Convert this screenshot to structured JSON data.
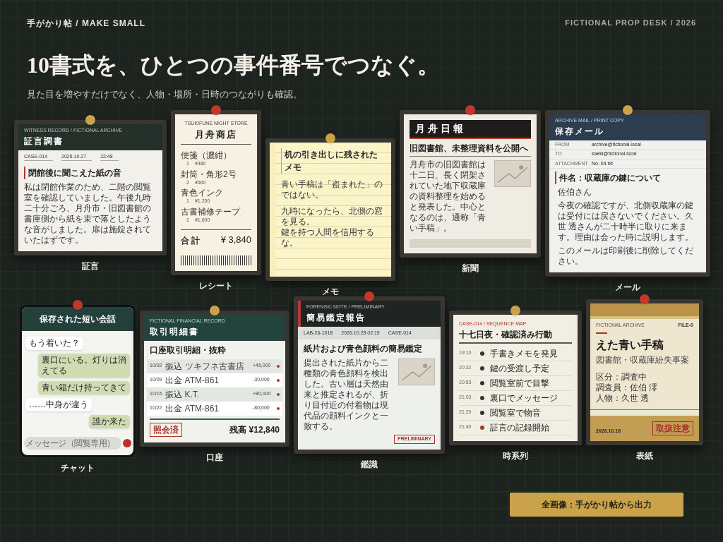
{
  "header": {
    "brand": "手がかり帖 / MAKE SMALL",
    "desk": "FICTIONAL PROP DESK / 2026"
  },
  "title": "10書式を、ひとつの事件番号でつなぐ。",
  "subtitle": "見た目を増やすだけでなく、人物・場所・日時のつながりも確認。",
  "cards": [
    {
      "kind": "testimony",
      "label": "証言",
      "color": "#c9a24a",
      "kicker": "WITNESS RECORD / FICTIONAL ARCHIVE",
      "header": "証言調書",
      "fields": [
        "CASE-014",
        "2026.10.27",
        "22:48"
      ],
      "heading": "閉館後に聞こえた紙の音",
      "body": "私は閉館作業のため、二階の閲覧室を確認していました。午後九時二十分ごろ、月舟市・旧図書館の書庫側から紙を束で落としたような音がしました。扉は施錠されていたはずです。"
    },
    {
      "kind": "receipt",
      "label": "レシート",
      "color": "#c0392b",
      "store_en": "TSUKIFUNE NIGHT STORE",
      "store": "月舟商店",
      "items": [
        {
          "name": "便箋（濃紺）",
          "qty": "1",
          "price": "¥480"
        },
        {
          "name": "封筒・角形2号",
          "qty": "2",
          "price": "¥560"
        },
        {
          "name": "青色インク",
          "qty": "1",
          "price": "¥1,200"
        },
        {
          "name": "古書補修テープ",
          "qty": "1",
          "price": "¥1,600"
        }
      ],
      "total_label": "合 計",
      "total": "¥ 3,840"
    },
    {
      "kind": "memo",
      "label": "メモ",
      "color": "#c9a24a",
      "heading": "机の引き出しに残されたメモ",
      "paragraphs": [
        [
          "青い手稿は「盗まれた」のではない。"
        ],
        [
          "九時になったら、北側の窓を見る。",
          "鍵を持つ人間を信用するな。"
        ]
      ]
    },
    {
      "kind": "news",
      "label": "新聞",
      "color": "#c0392b",
      "masthead": "月舟日報",
      "headline": "旧図書館、未整理資料を公開へ",
      "body": "月舟市の旧図書館は十二日、長く閉架されていた地下収蔵庫の資料整理を始めると発表した。中心となるのは、通称「青い手稿」。"
    },
    {
      "kind": "mail",
      "label": "メール",
      "color": "#c9a24a",
      "kicker": "ARCHIVE MAIL / PRINT COPY",
      "header": "保存メール",
      "rows": [
        {
          "key": "FROM",
          "value": "archive@fictional.local"
        },
        {
          "key": "TO",
          "value": "saeki@fictional.local"
        },
        {
          "key": "ATTACHMENT",
          "value": "No. 04.txt"
        }
      ],
      "subject": "件名：収蔵庫の鍵について",
      "paragraphs": [
        "佐伯さん",
        "今夜の確認ですが、北側収蔵庫の鍵は受付には戻さないでください。久世 透さんが二十時半に取りに来ます。理由は会った時に説明します。",
        "このメールは印刷後に削除してください。"
      ]
    },
    {
      "kind": "chat",
      "label": "チャット",
      "color": "#c0392b",
      "title": "保存された短い会話",
      "messages": [
        {
          "kind": "received",
          "text": "もう着いた？"
        },
        {
          "kind": "sent",
          "text": "裏口にいる。灯りは消えてる"
        },
        {
          "kind": "sent",
          "text": "青い箱だけ持ってきて"
        },
        {
          "kind": "received",
          "text": "……中身が違う"
        },
        {
          "kind": "sent",
          "text": "誰か来た"
        }
      ],
      "placeholder": "メッセージ（閲覧専用）"
    },
    {
      "kind": "bank",
      "label": "口座",
      "color": "#c9a24a",
      "kicker": "FICTIONAL FINANCIAL RECORD",
      "header": "取引明細書",
      "subtitle": "口座取引明細・抜粋",
      "rows": [
        {
          "date": "10/02",
          "type": "振込",
          "desc": "ツキフネ古書店",
          "amount": "+45,000"
        },
        {
          "date": "10/09",
          "type": "出金",
          "desc": "ATM-861",
          "amount": "-30,000"
        },
        {
          "date": "10/15",
          "type": "振込",
          "desc": "K.T.",
          "amount": "+80,000"
        },
        {
          "date": "10/22",
          "type": "出金",
          "desc": "ATM-861",
          "amount": "-80,000"
        }
      ],
      "balance": "残高 ¥12,840",
      "stamp": "照会済"
    },
    {
      "kind": "lab",
      "label": "鑑識",
      "color": "#c0392b",
      "kicker": "FORENSIC NOTE / PRELIMINARY",
      "header": "簡易鑑定報告",
      "fields": [
        "LAB-26-1018",
        "2026.10.28 02:15",
        "CASE-014"
      ],
      "heading": "紙片および青色顔料の簡易鑑定",
      "body": "提出された紙片から二種類の青色顔料を検出した。古い層は天然由来と推定されるが、折り目付近の付着物は現代品の顔料インクと一致する。",
      "stamp": "PRELIMINARY"
    },
    {
      "kind": "timeline",
      "label": "時系列",
      "color": "#c9a24a",
      "kicker": "CASE-014 / SEQUENCE MAP",
      "heading": "十七日夜・確認済み行動",
      "events": [
        {
          "time": "19:10",
          "text": "手書きメモを発見",
          "highlight": false
        },
        {
          "time": "20:32",
          "text": "鍵の受渡し予定",
          "highlight": false
        },
        {
          "time": "20:53",
          "text": "閲覧室前で目撃",
          "highlight": false
        },
        {
          "time": "21:03",
          "text": "裏口でメッセージ",
          "highlight": false
        },
        {
          "time": "21:20",
          "text": "閲覧室で物音",
          "highlight": false
        },
        {
          "time": "21:40",
          "text": "証言の記録開始",
          "highlight": true
        }
      ]
    },
    {
      "kind": "cover",
      "label": "表紙",
      "color": "#c0392b",
      "kicker": "FICTIONAL ARCHIVE",
      "file": "FILE-0",
      "title": "えた青い手稿",
      "subtitle": "図書館・収蔵庫紛失事案",
      "fields": [
        "区分：調査中",
        "調査員：佐伯 澪",
        "人物：久世 透"
      ],
      "stamp": "取扱注意",
      "footer": "2026.10.18"
    }
  ],
  "button": "全画像：手がかり帖から出力"
}
